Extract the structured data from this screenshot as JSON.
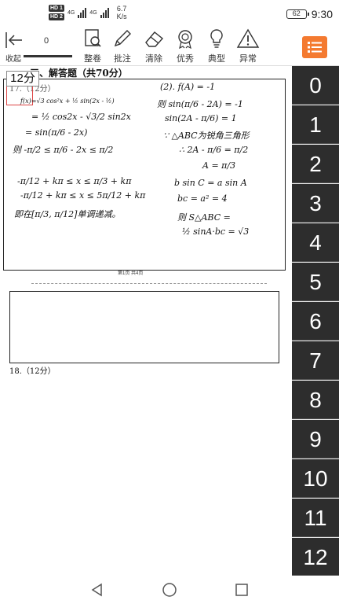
{
  "status_bar": {
    "hd1": "HD 1",
    "hd2": "HD 2",
    "net1": "4G",
    "net2": "4G",
    "speed_value": "6.7",
    "speed_unit": "K/s",
    "battery": "62",
    "time": "9:30"
  },
  "toolbar": {
    "collapse_label": "收起",
    "counter": "0",
    "tools": [
      {
        "label": "整卷",
        "icon": "scan-paper-icon"
      },
      {
        "label": "批注",
        "icon": "pencil-icon"
      },
      {
        "label": "清除",
        "icon": "eraser-icon"
      },
      {
        "label": "优秀",
        "icon": "medal-icon"
      },
      {
        "label": "典型",
        "icon": "lightbulb-icon"
      },
      {
        "label": "异常",
        "icon": "warning-icon"
      }
    ],
    "menu_color": "#f47a30"
  },
  "document": {
    "section_heading": "三、解答题（共70分）",
    "score_tag": "12分",
    "q17_label": "17.（12分）",
    "q18_label": "18.（12分）",
    "page_footer": "第1页  共4页",
    "handwriting": [
      "f(x)=√3 cos²x + ½ sin(2x - ½)",
      "= ½ cos2x - √3/2 sin2x",
      "= sin(π/6 - 2x)",
      "则 -π/2 ≤ π/6 - 2x ≤ π/2",
      "-π/12 + kπ ≤ x ≤ π/3 + kπ",
      "-π/12 + kπ ≤ x ≤ 5π/12 + kπ",
      "即在[π/3, π/12]单调递减。",
      "(2). f(A) = -1",
      "则 sin(π/6 - 2A) = -1",
      "sin(2A - π/6) = 1",
      "∵ △ABC为锐角三角形",
      "∴ 2A - π/6 = π/2",
      "A = π/3",
      "b sin C = a sin A",
      "bc = a² = 4",
      "则 S△ABC =",
      "½ sinA·bc = √3"
    ]
  },
  "score_panel": {
    "scores": [
      "0",
      "1",
      "2",
      "3",
      "4",
      "5",
      "6",
      "7",
      "8",
      "9",
      "10",
      "11",
      "12"
    ]
  },
  "nav": {
    "back": "back-icon",
    "home": "home-icon",
    "recent": "recent-apps-icon"
  }
}
